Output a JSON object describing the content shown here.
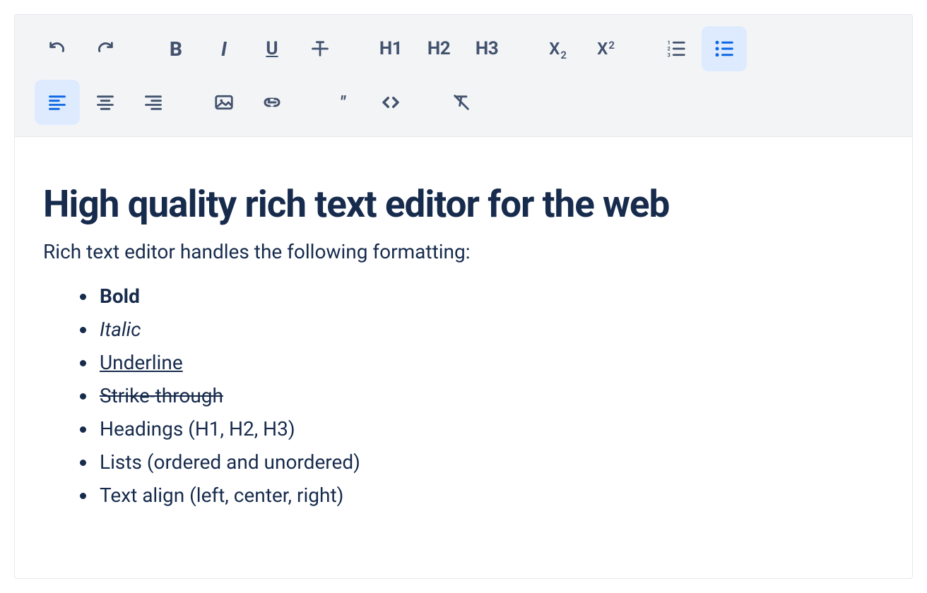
{
  "toolbar": {
    "headings": {
      "h1": "H1",
      "h2": "H2",
      "h3": "H3"
    },
    "subscript": {
      "x": "X",
      "sub": "2"
    },
    "superscript": {
      "x": "X",
      "sup": "2"
    },
    "active": {
      "unordered_list": true,
      "align_left": true
    }
  },
  "content": {
    "title": "High quality rich text editor for the web",
    "intro": "Rich text editor handles the following formatting:",
    "list": [
      {
        "text": "Bold",
        "style": "b"
      },
      {
        "text": "Italic",
        "style": "i"
      },
      {
        "text": "Underline",
        "style": "u"
      },
      {
        "text": "Strike-through",
        "style": "s"
      },
      {
        "text": "Headings (H1, H2, H3)",
        "style": ""
      },
      {
        "text": "Lists (ordered and unordered)",
        "style": ""
      },
      {
        "text": "Text align (left, center, right)",
        "style": ""
      }
    ]
  }
}
